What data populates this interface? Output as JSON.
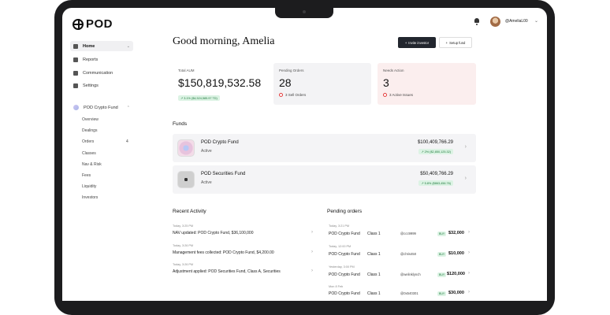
{
  "header": {
    "logo": "POD",
    "user": "@AmeliaL00"
  },
  "sidebar": {
    "items": [
      {
        "label": "Home",
        "icon": "home-icon"
      },
      {
        "label": "Reports",
        "icon": "reports-icon"
      },
      {
        "label": "Communication",
        "icon": "chat-icon"
      },
      {
        "label": "Settings",
        "icon": "gear-icon"
      }
    ],
    "fund": {
      "label": "POD Crypto Fund",
      "subitems": [
        "Overview",
        "Dealings",
        "Orders",
        "Classes",
        "Nav & Risk",
        "Fees",
        "Liquidity",
        "Investors"
      ],
      "orders_count": "4"
    }
  },
  "main": {
    "greeting": "Good morning, Amelia",
    "buttons": {
      "primary": "Invite investor",
      "secondary": "Setup fund"
    },
    "cards": {
      "aum": {
        "label": "Total AUM",
        "value": "$150,819,532.58",
        "change": "↗ 3.1% ($4,524,585.97 TD)"
      },
      "pending": {
        "label": "Pending Orders",
        "value": "28",
        "sub": "3 Sell Orders"
      },
      "needs": {
        "label": "Needs Action",
        "value": "3",
        "sub": "3 Active Issues"
      }
    },
    "funds_title": "Funds",
    "funds": [
      {
        "name": "POD Crypto Fund",
        "status": "Active",
        "amount": "$100,409,766.29",
        "change": "↗ 2% ($2,850,125.32)"
      },
      {
        "name": "POD Securities Fund",
        "status": "Active",
        "amount": "$50,409,766.29",
        "change": "↗ 5.8% ($863,456.76)"
      }
    ],
    "activity_title": "Recent Activity",
    "activity": [
      {
        "date": "Today, 3:25 PM",
        "text": "NAV updated: POD Crypto Fund, $36,100,000"
      },
      {
        "date": "Today, 3:26 PM",
        "text": "Management fees collected: POD Crypto Fund, $4,200.00"
      },
      {
        "date": "Today, 3:26 PM",
        "text": "Adjustment applied: POD Securities Fund, Class A, Securities"
      }
    ],
    "orders_title": "Pending orders",
    "orders": [
      {
        "date": "Today, 3:21 PM",
        "fund": "POD Crypto Fund",
        "class": "Class 1",
        "user": "@ccc9999",
        "type": "BUY",
        "amount": "$32,000"
      },
      {
        "date": "Today, 12:00 PM",
        "fund": "POD Crypto Fund",
        "class": "Class 1",
        "user": "@chris450",
        "type": "BUY",
        "amount": "$10,000"
      },
      {
        "date": "Yesterday, 3:00 PM",
        "fund": "POD Crypto Fund",
        "class": "Class 1",
        "user": "@welinklynch",
        "type": "BUY",
        "amount": "$120,000"
      },
      {
        "date": "Mon 8 Feb",
        "fund": "POD Crypto Fund",
        "class": "Class 1",
        "user": "@0x540301",
        "type": "BUY",
        "amount": "$30,000"
      }
    ]
  }
}
